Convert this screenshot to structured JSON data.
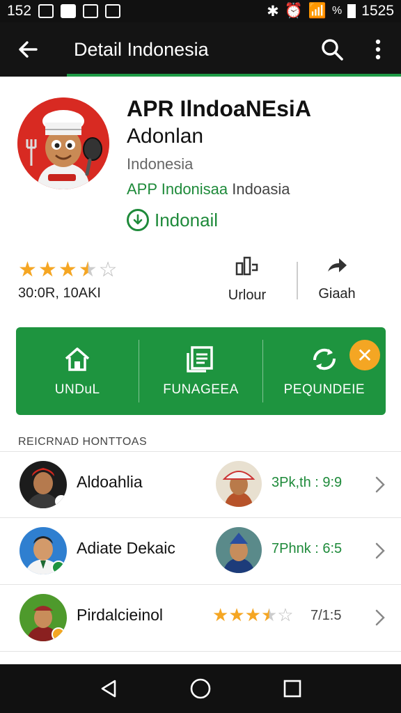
{
  "status_bar": {
    "time_left": "152",
    "battery_text": "%",
    "time_right": "1525"
  },
  "app_bar": {
    "title": "Detail Indonesia",
    "back_icon": "arrow-left-icon",
    "search_icon": "search-icon",
    "more_icon": "more-vert-icon"
  },
  "app": {
    "name": "APR IlndoaNEsiA",
    "subtitle": "Adonlan",
    "country": "Indonesia",
    "developer_green": "APP Indonisaa",
    "developer_gray": "Indoasia",
    "install_status": "Indonail",
    "logo_color": "#d82a22"
  },
  "stats": {
    "rating": 3.5,
    "rating_text": "30:0R, 10AKI",
    "col1_label": "Urlour",
    "col2_label": "Giaah"
  },
  "actions": [
    {
      "label": "UNDuL",
      "icon": "home-icon"
    },
    {
      "label": "FUNAGEEA",
      "icon": "document-icon"
    },
    {
      "label": "PEQUNDEIE",
      "icon": "refresh-icon"
    }
  ],
  "related": {
    "title": "REICRNAD HONTTOAS",
    "items": [
      {
        "name": "Aldoahlia",
        "rating_text": "3Pk,th : 9:9"
      },
      {
        "name": "Adiate Dekaic",
        "rating_text": "7Phnk : 6:5"
      },
      {
        "name": "Pirdalcieinol",
        "rating_text": "7/1:5",
        "stars": 3.5
      }
    ]
  },
  "colors": {
    "accent": "#1e943f",
    "star": "#f5a623",
    "badge": "#f4a623"
  }
}
